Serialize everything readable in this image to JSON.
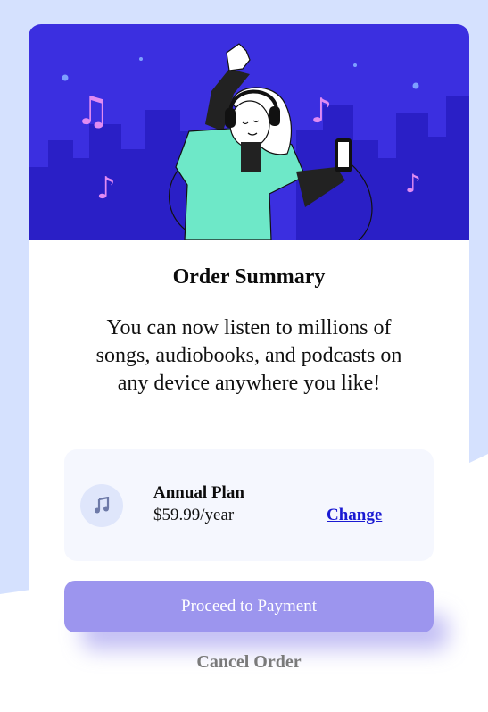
{
  "colors": {
    "page_bg": "#d5e1fe",
    "hero_bg": "#3b2fe0",
    "accent": "#9c95ee",
    "link": "#1a1ad2"
  },
  "card": {
    "title": "Order Summary",
    "description": "You can now listen to millions of songs, audiobooks, and podcasts on any device anywhere you like!"
  },
  "plan": {
    "icon": "music-note-icon",
    "name": "Annual Plan",
    "price": "$59.99/year",
    "change_label": "Change"
  },
  "actions": {
    "proceed_label": "Proceed to Payment",
    "cancel_label": "Cancel Order"
  }
}
